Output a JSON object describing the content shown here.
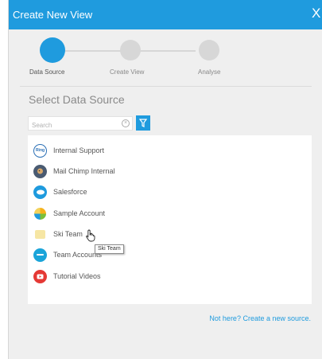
{
  "dialog": {
    "title": "Create New View",
    "close_glyph": "X"
  },
  "stepper": {
    "steps": [
      {
        "label": "Data Source",
        "state": "active"
      },
      {
        "label": "Create View",
        "state": "inactive"
      },
      {
        "label": "Analyse",
        "state": "inactive"
      }
    ]
  },
  "main": {
    "heading": "Select Data Source",
    "search": {
      "placeholder": "Search",
      "value": ""
    },
    "sources": [
      {
        "label": "Internal Support",
        "icon": "ring-brand-icon"
      },
      {
        "label": "Mail Chimp Internal",
        "icon": "mailchimp-icon"
      },
      {
        "label": "Salesforce",
        "icon": "salesforce-cloud-icon"
      },
      {
        "label": "Sample Account",
        "icon": "pinwheel-icon"
      },
      {
        "label": "Ski Team",
        "icon": "folder-icon"
      },
      {
        "label": "Team Accounts",
        "icon": "team-accounts-icon"
      },
      {
        "label": "Tutorial Videos",
        "icon": "youtube-play-icon"
      }
    ],
    "tooltip": "Ski Team",
    "create_link": "Not here? Create a new source."
  },
  "colors": {
    "accent": "#1f9bde",
    "panel_bg": "#efefef",
    "youtube_red": "#e53935",
    "folder_yellow": "#f6e6a4"
  }
}
